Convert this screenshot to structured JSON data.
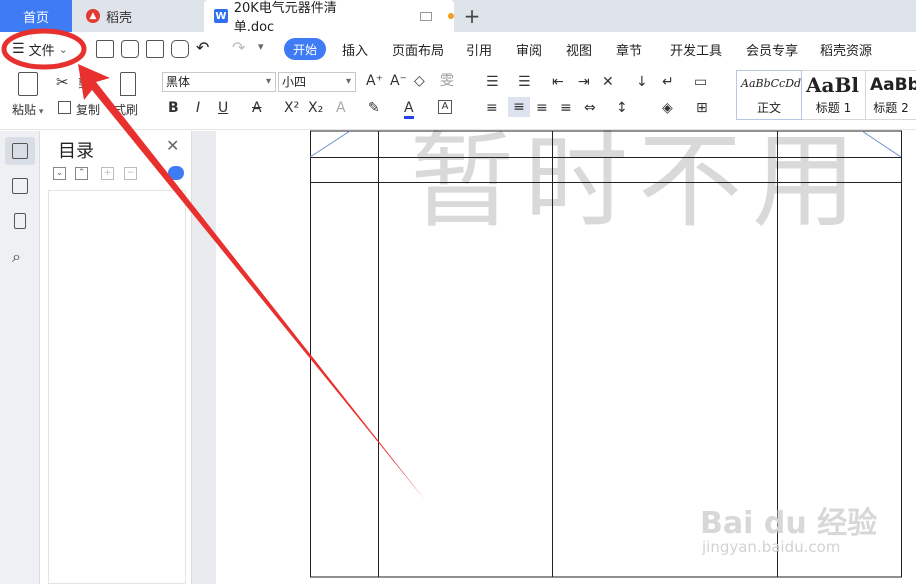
{
  "tabs": {
    "home": "首页",
    "daoke": "稻壳",
    "doc": "20K电气元器件清单.doc",
    "new_tab": "+"
  },
  "menu": {
    "file": "文件",
    "items": [
      "开始",
      "插入",
      "页面布局",
      "引用",
      "审阅",
      "视图",
      "章节",
      "开发工具",
      "会员专享",
      "稻壳资源"
    ]
  },
  "toolbar": {
    "paste": "粘贴",
    "cut": "剪",
    "copy": "复制",
    "format_painter": "式刷",
    "font_name": "黑体",
    "font_size": "小四",
    "styles": [
      {
        "sample": "AaBbCcDd",
        "name": "正文"
      },
      {
        "sample": "AaBl",
        "name": "标题 1"
      },
      {
        "sample": "AaBb",
        "name": "标题 2"
      }
    ]
  },
  "toc": {
    "title": "目录",
    "close": "✕"
  },
  "document": {
    "watermark": "暂时不用"
  },
  "watermark_site": {
    "brand": "Bai du 经验",
    "url": "jingyan.baidu.com"
  },
  "colors": {
    "accent": "#3e7bf5",
    "annotation": "#e8312f"
  }
}
